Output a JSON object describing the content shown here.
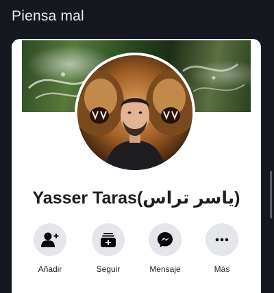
{
  "post": {
    "title": "Piensa mal"
  },
  "profile": {
    "name": "Yasser Taras",
    "name_arabic": "(ياسر تراس)"
  },
  "actions": [
    {
      "label": "Añadir",
      "icon": "add-friend-icon"
    },
    {
      "label": "Seguir",
      "icon": "follow-icon"
    },
    {
      "label": "Mensaje",
      "icon": "messenger-icon"
    },
    {
      "label": "Más",
      "icon": "more-icon"
    }
  ],
  "colors": {
    "background": "#15181e",
    "card": "#ffffff",
    "action_circle": "#e4e6eb",
    "icon": "#050505",
    "text": "#1c1e21"
  }
}
